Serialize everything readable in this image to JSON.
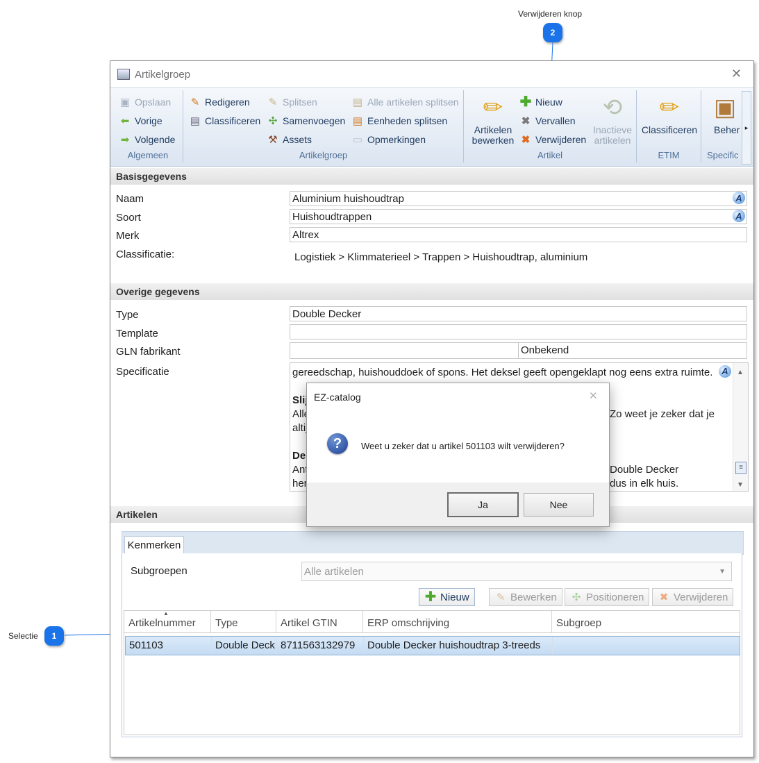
{
  "callouts": {
    "top": {
      "number": "2",
      "label": "Verwijderen knop"
    },
    "left": {
      "number": "1",
      "label": "Selectie"
    }
  },
  "window": {
    "title": "Artikelgroep",
    "close_glyph": "✕"
  },
  "ribbon": {
    "algemeen": {
      "label": "Algemeen",
      "save": "Opslaan",
      "prev": "Vorige",
      "next": "Volgende"
    },
    "artikelgroep": {
      "label": "Artikelgroep",
      "edit": "Redigeren",
      "classify": "Classificeren",
      "split": "Splitsen",
      "merge": "Samenvoegen",
      "assets": "Assets",
      "split_all": "Alle artikelen splitsen",
      "split_units": "Eenheden splitsen",
      "remarks": "Opmerkingen"
    },
    "artikel": {
      "label": "Artikel",
      "edit_line1": "Artikelen",
      "edit_line2": "bewerken",
      "new": "Nieuw",
      "expire": "Vervallen",
      "delete": "Verwijderen",
      "inactive_line1": "Inactieve",
      "inactive_line2": "artikelen"
    },
    "etim": {
      "label": "ETIM",
      "classify": "Classificeren"
    },
    "specific": {
      "label": "Specific",
      "manage": "Beher",
      "scroll_glyph": "▸"
    }
  },
  "basis": {
    "header": "Basisgegevens",
    "naam_label": "Naam",
    "naam_value": "Aluminium huishoudtrap",
    "soort_label": "Soort",
    "soort_value": "Huishoudtrappen",
    "merk_label": "Merk",
    "merk_value": "Altrex",
    "class_label": "Classificatie:",
    "class_value": "Logistiek > Klimmaterieel > Trappen > Huishoudtrap, aluminium"
  },
  "overige": {
    "header": "Overige gegevens",
    "type_label": "Type",
    "type_value": "Double Decker",
    "template_label": "Template",
    "template_value": "",
    "gln_label": "GLN fabrikant",
    "gln_value": "",
    "gln_status": "Onbekend",
    "spec_label": "Specificatie",
    "spec_lines": {
      "l1": "gereedschap, huishouddoek of spons. Het deksel geeft opengeklapt nog eens extra ruimte.",
      "l2": "Slij",
      "l3a": "Alle",
      "l3b": "Zo weet je zeker dat je",
      "l4": "altij",
      "l5": "De",
      "l6a": "Ant",
      "l6b": "Double Decker",
      "l7a": "her",
      "l7b": "dus in elk huis."
    }
  },
  "artikelen": {
    "header": "Artikelen",
    "tab": "Kenmerken",
    "subgroepen_label": "Subgroepen",
    "subgroepen_value": "Alle artikelen",
    "buttons": {
      "new": "Nieuw",
      "edit": "Bewerken",
      "position": "Positioneren",
      "delete": "Verwijderen"
    },
    "columns": [
      "Artikelnummer",
      "Type",
      "Artikel GTIN",
      "ERP omschrijving",
      "Subgroep"
    ],
    "rows": [
      {
        "nummer": "501103",
        "type": "Double Deck",
        "gtin": "8711563132979",
        "erp": "Double Decker huishoudtrap 3-treeds",
        "subgroep": ""
      }
    ]
  },
  "dialog": {
    "title": "EZ-catalog",
    "message": "Weet u zeker dat u artikel 501103 wilt verwijderen?",
    "yes": "Ja",
    "no": "Nee"
  },
  "colors": {
    "accent": "#1a73e8",
    "ribbon_text": "#1e3a5f",
    "selection": "#cfe3f7"
  }
}
